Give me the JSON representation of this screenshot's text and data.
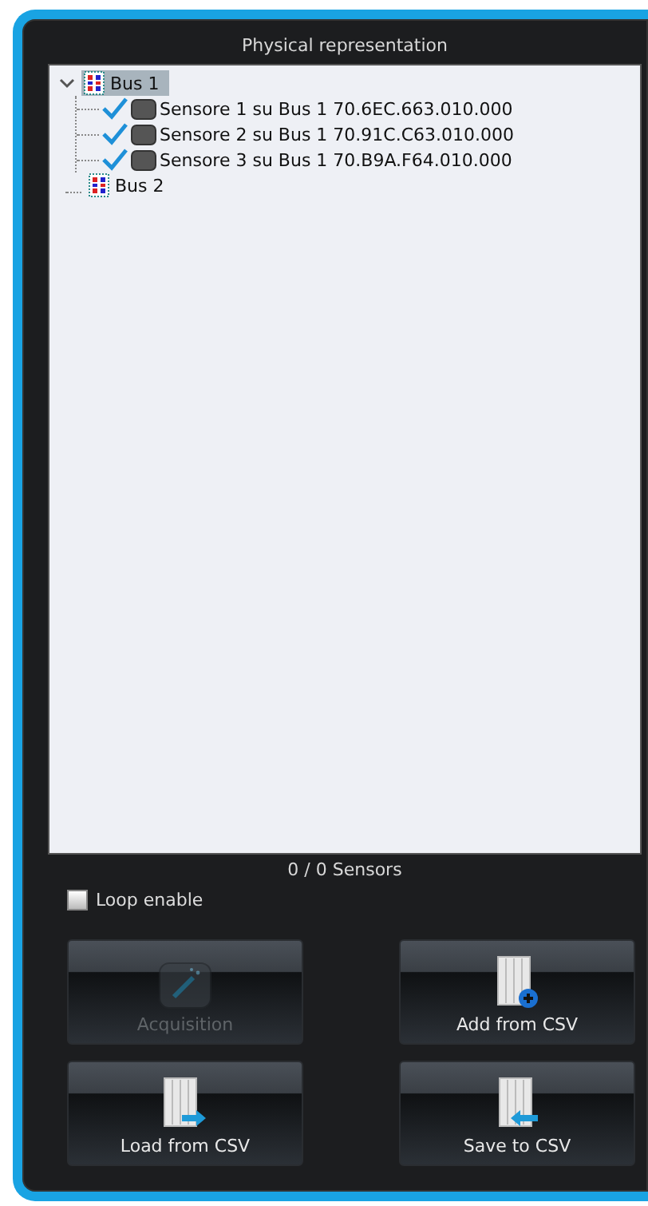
{
  "panel": {
    "title": "Physical representation"
  },
  "tree": [
    {
      "label": "Bus 1",
      "expanded": true,
      "selected": true,
      "children": [
        {
          "label": "Sensore 1 su Bus 1 70.6EC.663.010.000",
          "checked": true
        },
        {
          "label": "Sensore 2 su Bus 1 70.91C.C63.010.000",
          "checked": true
        },
        {
          "label": "Sensore 3 su Bus 1 70.B9A.F64.010.000",
          "checked": true
        }
      ]
    },
    {
      "label": "Bus 2",
      "expanded": false,
      "selected": false
    }
  ],
  "counter": "0 / 0 Sensors",
  "loop": {
    "label": "Loop enable",
    "checked": false
  },
  "buttons": [
    {
      "label": "Acquisition",
      "kind": "wand",
      "disabled": true
    },
    {
      "label": "Add from CSV",
      "kind": "add",
      "disabled": false
    },
    {
      "label": "Load from CSV",
      "kind": "load",
      "disabled": false
    },
    {
      "label": "Save to CSV",
      "kind": "save",
      "disabled": false
    }
  ]
}
